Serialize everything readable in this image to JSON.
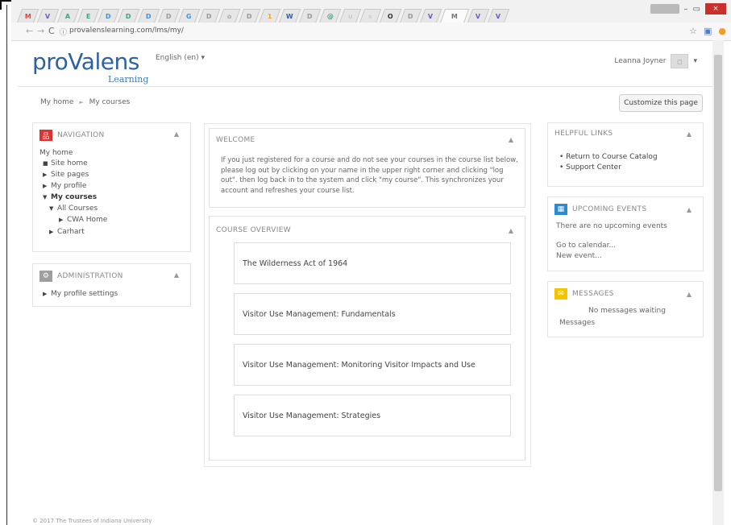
{
  "browser": {
    "tabs": [
      {
        "letter": "M",
        "color": "#d44"
      },
      {
        "letter": "V",
        "color": "#6a5acd"
      },
      {
        "letter": "A",
        "color": "#3a8"
      },
      {
        "letter": "E",
        "color": "#3a8"
      },
      {
        "letter": "D",
        "color": "#4a90d9"
      },
      {
        "letter": "D",
        "color": "#3a8"
      },
      {
        "letter": "D",
        "color": "#4a90d9"
      },
      {
        "letter": "D",
        "color": "#999"
      },
      {
        "letter": "G",
        "color": "#4a90d9"
      },
      {
        "letter": "D",
        "color": "#999"
      },
      {
        "letter": "o",
        "color": "#aaa"
      },
      {
        "letter": "D",
        "color": "#999"
      },
      {
        "letter": "1",
        "color": "#f0a030"
      },
      {
        "letter": "W",
        "color": "#3b5998"
      },
      {
        "letter": "D",
        "color": "#999"
      },
      {
        "letter": "@",
        "color": "#2a7"
      },
      {
        "letter": "u",
        "color": "#ccc"
      },
      {
        "letter": "s",
        "color": "#ccc"
      },
      {
        "letter": "O",
        "color": "#333"
      },
      {
        "letter": "D",
        "color": "#999"
      },
      {
        "letter": "V",
        "color": "#6a5acd"
      },
      {
        "letter": "M",
        "color": "#777",
        "active": true
      },
      {
        "letter": "V",
        "color": "#6a5acd"
      },
      {
        "letter": "V",
        "color": "#6a5acd"
      }
    ],
    "url": "provalenslearning.com/lms/my/",
    "win_close": "×",
    "win_min": "–",
    "win_max": "▭"
  },
  "header": {
    "logo_main": "proValens",
    "logo_sub": "Learning",
    "language": "English (en) ▾",
    "user_name": "Leanna Joyner",
    "user_menu": "▾"
  },
  "breadcrumb": {
    "home": "My home",
    "sep": "►",
    "current": "My courses"
  },
  "customize_label": "Customize this page",
  "navigation": {
    "title": "NAVIGATION",
    "items": {
      "my_home": "My home",
      "site_home": "Site home",
      "site_pages": "Site pages",
      "my_profile": "My profile",
      "my_courses": "My courses",
      "all_courses": "All Courses",
      "cwa_home": "CWA Home",
      "carhart": "Carhart"
    }
  },
  "administration": {
    "title": "ADMINISTRATION",
    "profile_settings": "My profile settings"
  },
  "welcome": {
    "title": "WELCOME",
    "text": "If you just registered for a course and do not see your courses in the course list below, please log out by clicking on your name in the upper right corner and clicking \"log out\". then log back in to the system and click \"my course\". This synchronizes your account and refreshes your course list."
  },
  "course_overview": {
    "title": "COURSE OVERVIEW",
    "courses": [
      "The Wilderness Act of 1964",
      "Visitor Use Management: Fundamentals",
      "Visitor Use Management: Monitoring Visitor Impacts and Use",
      "Visitor Use Management: Strategies"
    ]
  },
  "helpful_links": {
    "title": "HELPFUL LINKS",
    "links": [
      "Return to Course Catalog",
      "Support Center"
    ]
  },
  "upcoming_events": {
    "title": "UPCOMING EVENTS",
    "empty": "There are no upcoming events",
    "go_to_calendar": "Go to calendar...",
    "new_event": "New event..."
  },
  "messages": {
    "title": "MESSAGES",
    "empty": "No messages waiting",
    "link": "Messages"
  },
  "footer": "© 2017 The Trustees of Indiana University",
  "colors": {
    "accent": "#2d62a0",
    "nav_icon": "#e03131",
    "cal_icon": "#2b8ad0",
    "msg_icon": "#f5c400"
  }
}
